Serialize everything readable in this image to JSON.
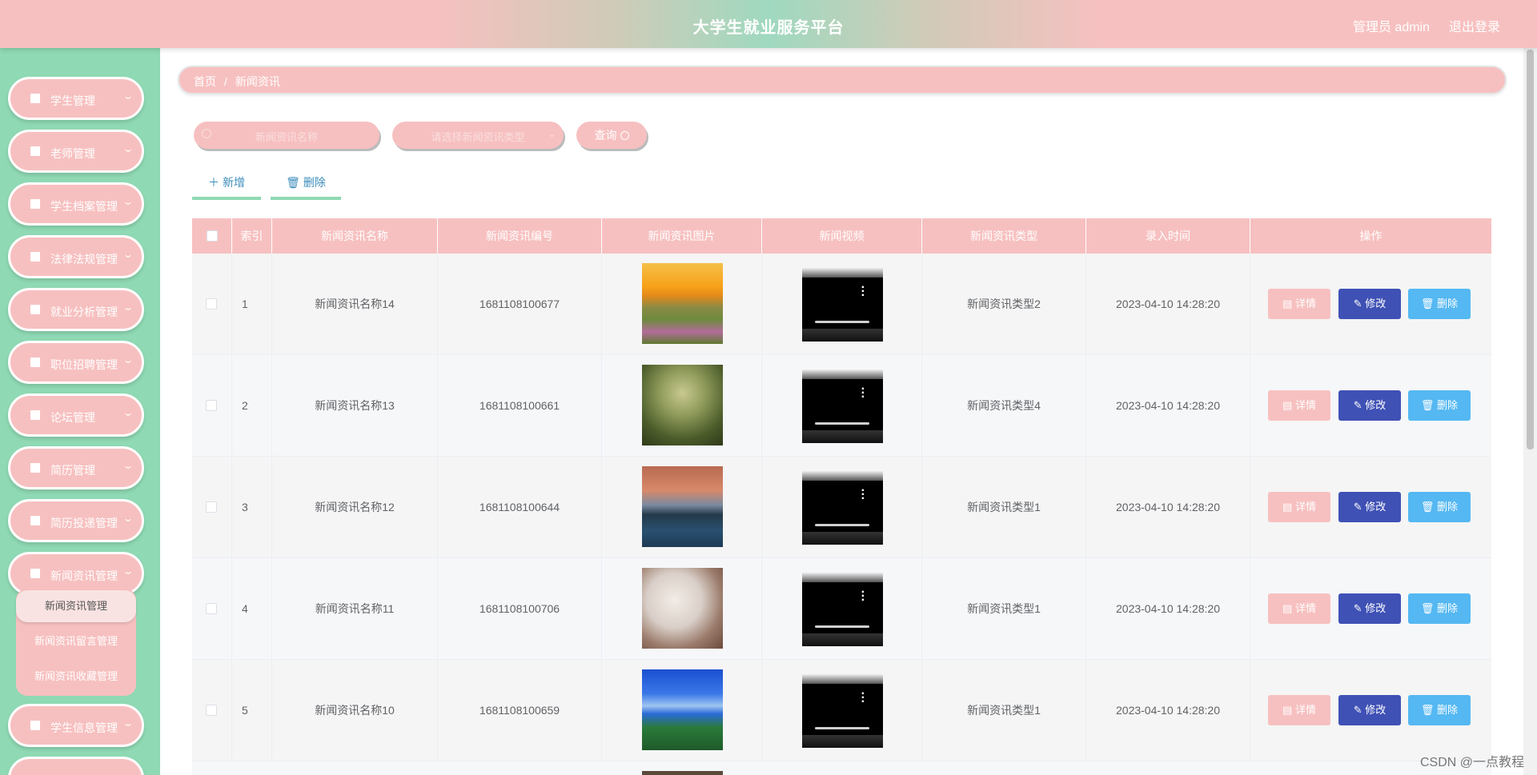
{
  "header": {
    "title": "大学生就业服务平台",
    "user": "管理员 admin",
    "logout": "退出登录"
  },
  "sidebar": {
    "items": [
      {
        "label": "",
        "icon": "grid-icon"
      },
      {
        "label": "学生管理",
        "icon": "briefcase-icon"
      },
      {
        "label": "老师管理",
        "icon": "clipboard-icon"
      },
      {
        "label": "学生档案管理",
        "icon": "grid-icon"
      },
      {
        "label": "法律法规管理",
        "icon": "chart-icon"
      },
      {
        "label": "就业分析管理",
        "icon": "bar-chart-icon"
      },
      {
        "label": "职位招聘管理",
        "icon": "grid-icon"
      },
      {
        "label": "论坛管理",
        "icon": "grid-icon"
      },
      {
        "label": "简历管理",
        "icon": "list-icon"
      },
      {
        "label": "简历投递管理",
        "icon": "grid-icon"
      },
      {
        "label": "新闻资讯管理",
        "icon": "clipboard-icon"
      },
      {
        "label": "学生信息管理",
        "icon": "grid-icon"
      },
      {
        "label": "",
        "icon": "grid-icon"
      }
    ],
    "submenu": [
      "新闻资讯管理",
      "新闻资讯留言管理",
      "新闻资讯收藏管理"
    ]
  },
  "breadcrumb": {
    "home": "首页",
    "sep": "/",
    "current": "新闻资讯"
  },
  "search": {
    "name_placeholder": "新闻资讯名称",
    "type_placeholder": "请选择新闻资讯类型",
    "query_label": "查询"
  },
  "toolbar": {
    "add_label": "新增",
    "delete_label": "删除"
  },
  "table": {
    "headers": [
      "索引",
      "新闻资讯名称",
      "新闻资讯编号",
      "新闻资讯图片",
      "新闻视频",
      "新闻资讯类型",
      "录入时间",
      "操作"
    ],
    "rows": [
      {
        "index": "1",
        "name": "新闻资讯名称14",
        "code": "1681108100677",
        "type": "新闻资讯类型2",
        "time": "2023-04-10 14:28:20"
      },
      {
        "index": "2",
        "name": "新闻资讯名称13",
        "code": "1681108100661",
        "type": "新闻资讯类型4",
        "time": "2023-04-10 14:28:20"
      },
      {
        "index": "3",
        "name": "新闻资讯名称12",
        "code": "1681108100644",
        "type": "新闻资讯类型1",
        "time": "2023-04-10 14:28:20"
      },
      {
        "index": "4",
        "name": "新闻资讯名称11",
        "code": "1681108100706",
        "type": "新闻资讯类型1",
        "time": "2023-04-10 14:28:20"
      },
      {
        "index": "5",
        "name": "新闻资讯名称10",
        "code": "1681108100659",
        "type": "新闻资讯类型1",
        "time": "2023-04-10 14:28:20"
      }
    ],
    "actions": {
      "detail": "详情",
      "edit": "修改",
      "delete": "删除"
    }
  },
  "watermark": "CSDN @一点教程",
  "colors": {
    "pink": "#f7c0c0",
    "mint": "#8fd9b4",
    "indigo": "#3f51b5",
    "sky": "#55b8f2"
  }
}
